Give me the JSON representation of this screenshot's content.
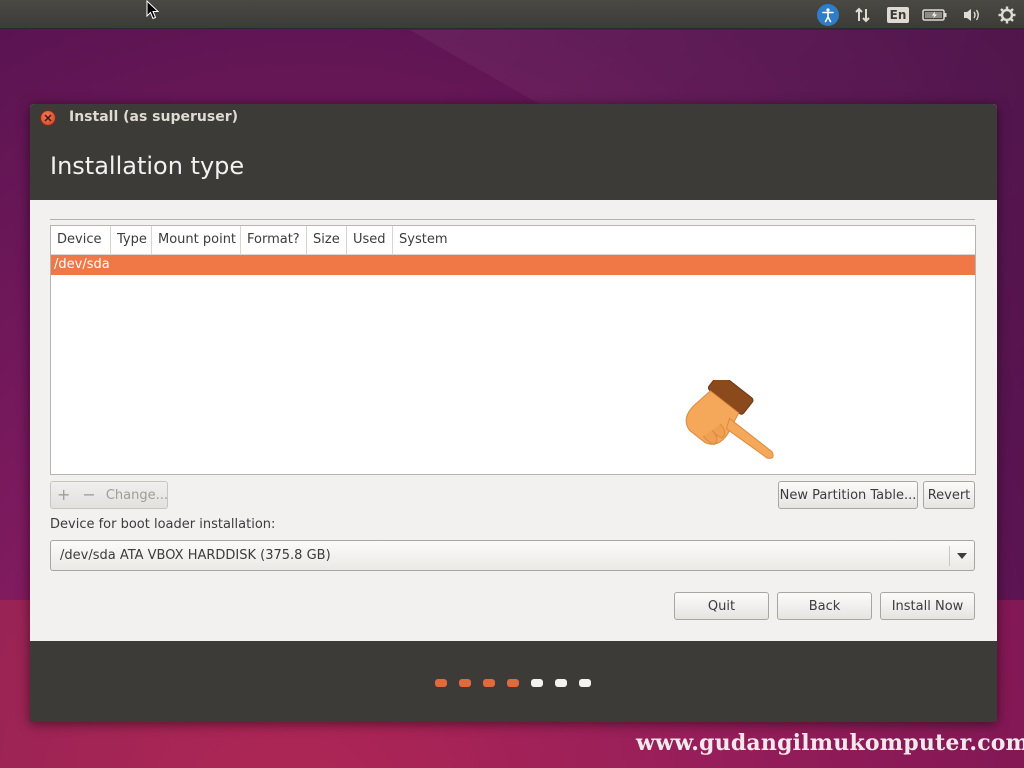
{
  "desktop": {
    "tray": {
      "accessibility_icon": "accessibility-icon",
      "network_icon": "network-updown-icon",
      "language_indicator": "En",
      "battery_icon": "battery-icon",
      "volume_icon": "volume-icon",
      "settings_icon": "gear-icon"
    },
    "watermark": "www.gudangilmukomputer.com"
  },
  "window": {
    "title": "Install (as superuser)",
    "page_title": "Installation type",
    "partition_table": {
      "columns": [
        "Device",
        "Type",
        "Mount point",
        "Format?",
        "Size",
        "Used",
        "System"
      ],
      "rows": [
        {
          "device": "/dev/sda",
          "selected": true
        }
      ]
    },
    "toolbar": {
      "add_label": "+",
      "remove_label": "−",
      "change_label": "Change..."
    },
    "new_partition_table_label": "New Partition Table...",
    "revert_label": "Revert",
    "boot_loader": {
      "label": "Device for boot loader installation:",
      "selected": "/dev/sda ATA VBOX HARDDISK (375.8 GB)"
    },
    "buttons": {
      "quit": "Quit",
      "back": "Back",
      "install_now": "Install Now"
    },
    "progress": {
      "total_steps": 7,
      "completed_steps": 4
    }
  },
  "colors": {
    "accent": "#f07746",
    "header_bg": "#3c3b37",
    "window_bg": "#f2f1f0",
    "dot_done": "#e26a3a",
    "dot_todo": "#f4f3f1"
  }
}
